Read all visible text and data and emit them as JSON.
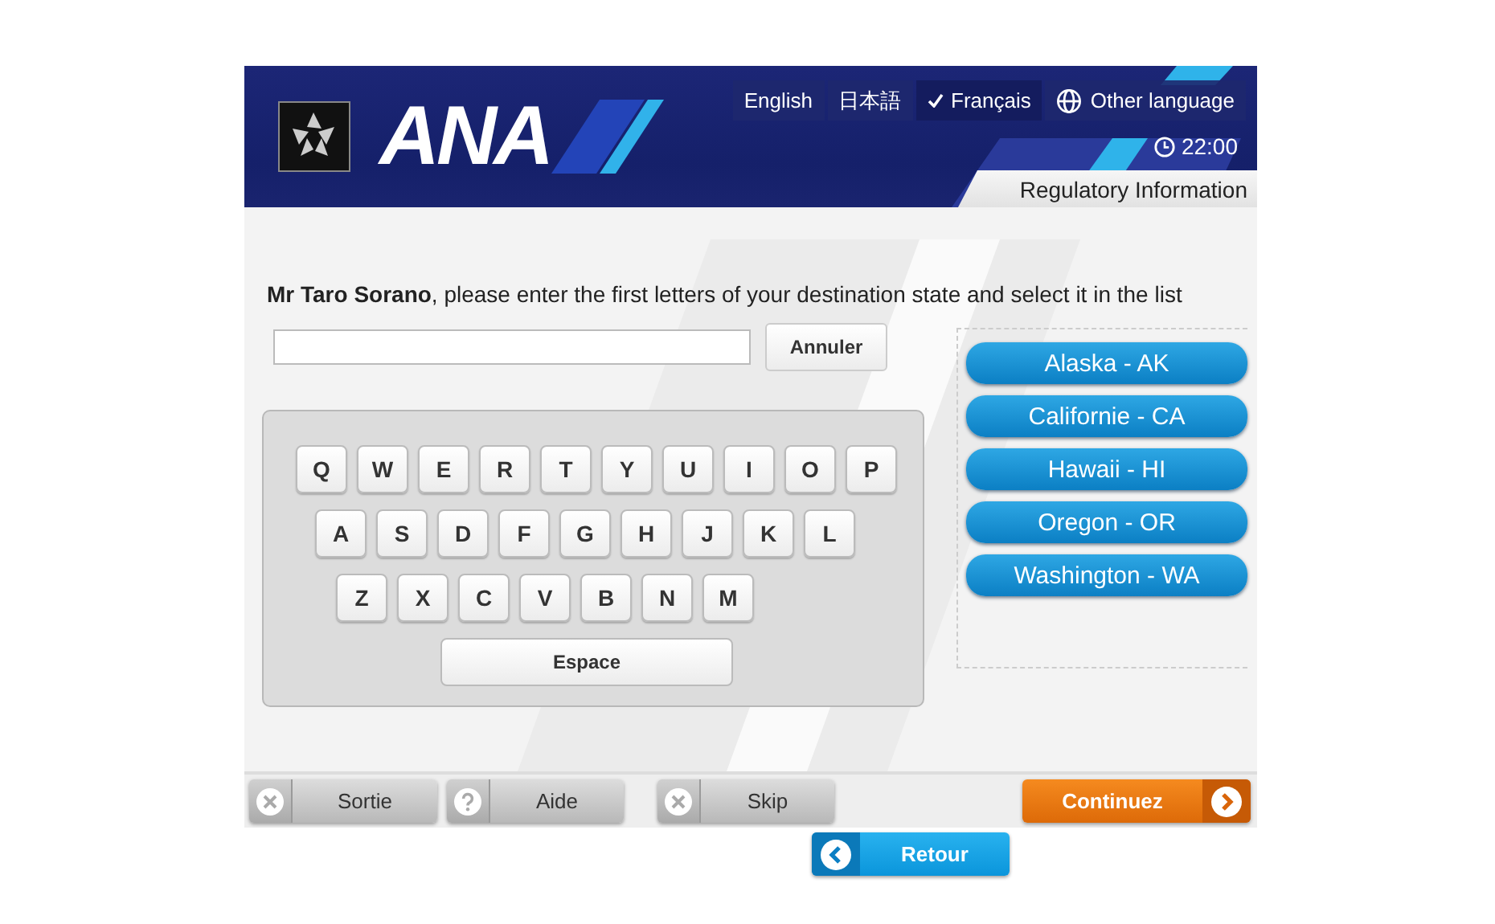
{
  "header": {
    "logo": "ANA",
    "languages": [
      {
        "label": "English",
        "kind": "language",
        "selected": false
      },
      {
        "label": "日本語",
        "kind": "language",
        "selected": false
      },
      {
        "label": "Français",
        "kind": "language",
        "selected": true
      },
      {
        "label": "Other language",
        "kind": "more",
        "selected": false
      }
    ],
    "time": "22:00",
    "section": "Regulatory Information"
  },
  "prompt": "**Mr Taro Sorano**, please enter the first letters of your destination state and select it in the list",
  "cancel_button": "Annuler",
  "keyboard": {
    "rows": [
      [
        "Q",
        "W",
        "E",
        "R",
        "T",
        "Y",
        "U",
        "I",
        "O",
        "P"
      ],
      [
        "A",
        "S",
        "D",
        "F",
        "G",
        "H",
        "J",
        "K",
        "L"
      ],
      [
        "Z",
        "X",
        "C",
        "V",
        "B",
        "N",
        "M"
      ]
    ],
    "space": "Espace"
  },
  "states": [
    "Alaska - AK",
    "Californie - CA",
    "Hawaii - HI",
    "Oregon - OR",
    "Washington - WA"
  ],
  "footer": [
    {
      "label": "Sortie",
      "kind": "exit"
    },
    {
      "label": "Aide",
      "kind": "help"
    },
    {
      "label": "Skip",
      "kind": "skip"
    },
    {
      "label": "Continuez",
      "kind": "next"
    }
  ],
  "back_button": "Retour"
}
